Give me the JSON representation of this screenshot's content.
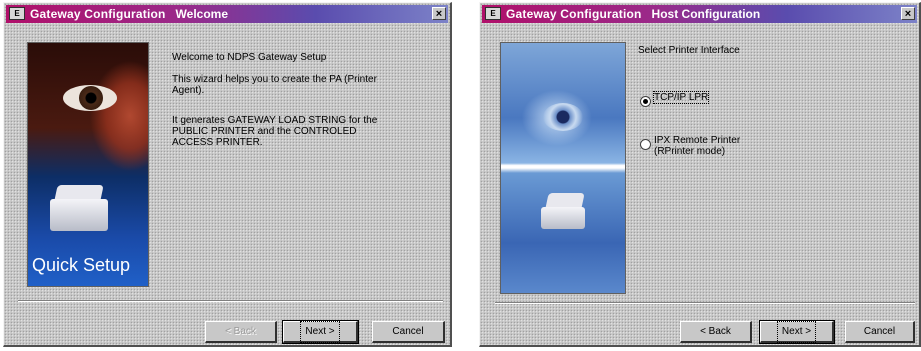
{
  "window1": {
    "title_app": "Gateway Configuration",
    "title_page": "Welcome",
    "close_label": "×",
    "art_caption": "Quick Setup",
    "heading": "Welcome to NDPS Gateway Setup",
    "intro": "This wizard helps you to create the PA (Printer Agent).",
    "detail": "It generates GATEWAY LOAD STRING for the PUBLIC PRINTER and the CONTROLED ACCESS PRINTER.",
    "buttons": {
      "back": "< Back",
      "next": "Next >",
      "cancel": "Cancel"
    }
  },
  "window2": {
    "title_app": "Gateway Configuration",
    "title_page": "Host Configuration",
    "close_label": "×",
    "heading": "Select Printer Interface",
    "options": [
      {
        "label": "TCP/IP LPR",
        "selected": true
      },
      {
        "label": "IPX Remote Printer\n(RPrinter mode)",
        "selected": false
      }
    ],
    "buttons": {
      "back": "< Back",
      "next": "Next >",
      "cancel": "Cancel"
    }
  },
  "app_icon_glyph": "E",
  "colors": {
    "titlebar_start": "#b0106a",
    "titlebar_end": "#7c82c8",
    "dialog_face": "#c8c8c8"
  }
}
